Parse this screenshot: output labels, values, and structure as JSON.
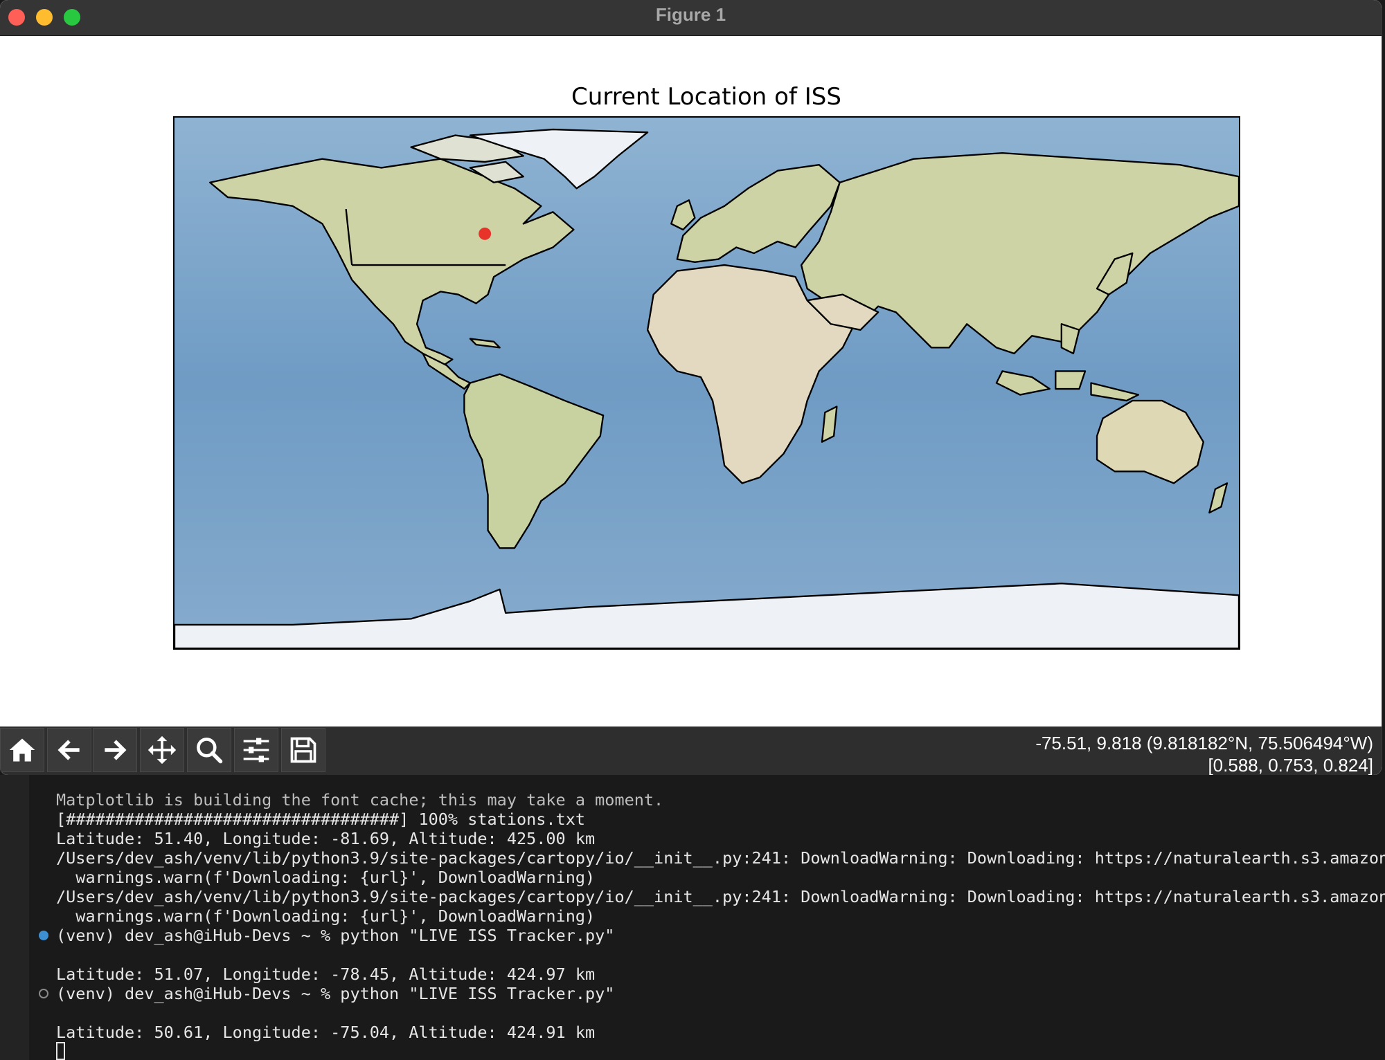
{
  "window": {
    "title": "Figure 1"
  },
  "figure": {
    "title": "Current Location of ISS",
    "iss_marker": {
      "lat": 50.61,
      "lon": -75.04,
      "color": "#e8332a"
    },
    "map_colors": {
      "ocean": "#7fa6c8",
      "land": "#cfd4a8",
      "desert": "#e4dcc4",
      "ice": "#edf0f4",
      "borders": "#000000"
    }
  },
  "toolbar": {
    "buttons": [
      {
        "name": "home-button",
        "icon": "home-icon"
      },
      {
        "name": "back-button",
        "icon": "arrow-left-icon"
      },
      {
        "name": "forward-button",
        "icon": "arrow-right-icon"
      },
      {
        "name": "pan-button",
        "icon": "move-icon"
      },
      {
        "name": "zoom-button",
        "icon": "magnifier-icon"
      },
      {
        "name": "configure-subplots-button",
        "icon": "sliders-icon"
      },
      {
        "name": "save-button",
        "icon": "floppy-disk-icon"
      }
    ],
    "coords_line1": "-75.51, 9.818 (9.818182°N, 75.506494°W)",
    "coords_line2": "[0.588, 0.753, 0.824]"
  },
  "terminal": {
    "lines": [
      "Matplotlib is building the font cache; this may take a moment.",
      "[##################################] 100% stations.txt",
      "Latitude: 51.40, Longitude: -81.69, Altitude: 425.00 km",
      "/Users/dev_ash/venv/lib/python3.9/site-packages/cartopy/io/__init__.py:241: DownloadWarning: Downloading: https://naturalearth.s3.amazona",
      "  warnings.warn(f'Downloading: {url}', DownloadWarning)",
      "/Users/dev_ash/venv/lib/python3.9/site-packages/cartopy/io/__init__.py:241: DownloadWarning: Downloading: https://naturalearth.s3.amazona",
      "  warnings.warn(f'Downloading: {url}', DownloadWarning)",
      "(venv) dev_ash@iHub-Devs ~ % python \"LIVE ISS Tracker.py\"",
      "",
      "Latitude: 51.07, Longitude: -78.45, Altitude: 424.97 km",
      "(venv) dev_ash@iHub-Devs ~ % python \"LIVE ISS Tracker.py\"",
      "",
      "Latitude: 50.61, Longitude: -75.04, Altitude: 424.91 km"
    ]
  }
}
